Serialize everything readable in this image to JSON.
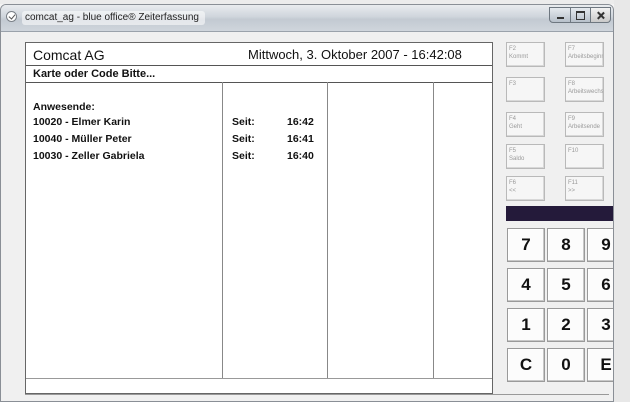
{
  "window": {
    "title": "comcat_ag - blue office® Zeiterfassung"
  },
  "header": {
    "company": "Comcat AG",
    "datetime": "Mittwoch, 3. Oktober 2007 - 16:42:08",
    "prompt": "Karte oder Code Bitte..."
  },
  "attendance": {
    "label": "Anwesende:",
    "rows": [
      {
        "name": "10020 - Elmer Karin",
        "since": "Seit:",
        "time": "16:42"
      },
      {
        "name": "10040 - Müller Peter",
        "since": "Seit:",
        "time": "16:41"
      },
      {
        "name": "10030 - Zeller Gabriela",
        "since": "Seit:",
        "time": "16:40"
      }
    ]
  },
  "function_keys": [
    {
      "key": "F2",
      "label": "Kommt"
    },
    {
      "key": "F7",
      "label": "Arbeitsbeginn"
    },
    {
      "key": "F3",
      "label": ""
    },
    {
      "key": "F8",
      "label": "Arbeitswechsel"
    },
    {
      "key": "F4",
      "label": "Geht"
    },
    {
      "key": "F9",
      "label": "Arbeitsende"
    },
    {
      "key": "F5",
      "label": "Saldo"
    },
    {
      "key": "F10",
      "label": ""
    },
    {
      "key": "F6",
      "label": "<<"
    },
    {
      "key": "F11",
      "label": ">>"
    }
  ],
  "keypad": [
    "7",
    "8",
    "9",
    "4",
    "5",
    "6",
    "1",
    "2",
    "3",
    "C",
    "0",
    "E"
  ],
  "colors": {
    "display_bar": "#241a3a"
  }
}
